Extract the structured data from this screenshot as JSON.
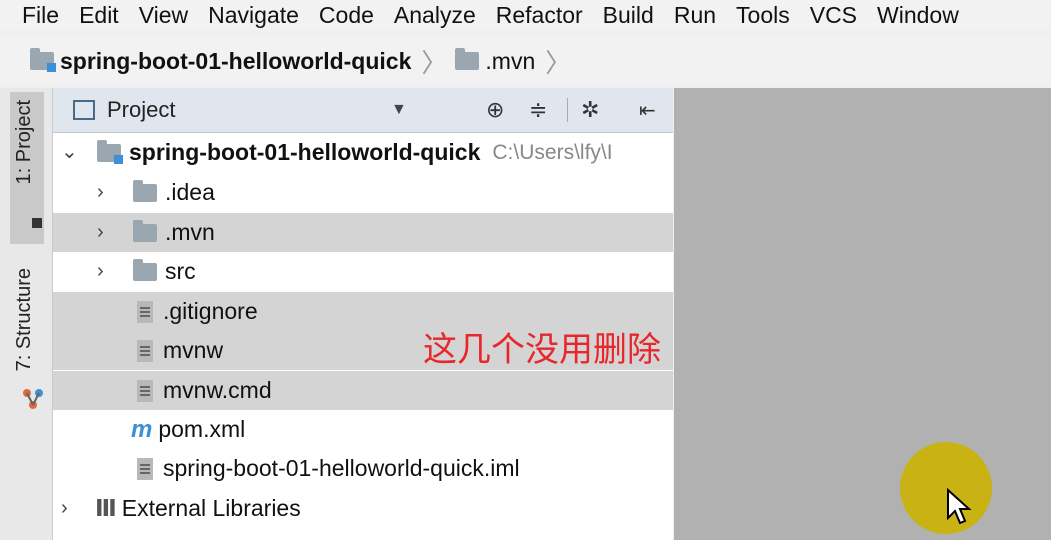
{
  "menu": [
    "File",
    "Edit",
    "View",
    "Navigate",
    "Code",
    "Analyze",
    "Refactor",
    "Build",
    "Run",
    "Tools",
    "VCS",
    "Window"
  ],
  "breadcrumb": {
    "project": "spring-boot-01-helloworld-quick",
    "folder": ".mvn"
  },
  "side_tabs": {
    "project": "1: Project",
    "structure": "7: Structure"
  },
  "panel": {
    "title": "Project"
  },
  "tree": {
    "root": "spring-boot-01-helloworld-quick",
    "root_path": "C:\\Users\\lfy\\I",
    "items": [
      ".idea",
      ".mvn",
      "src",
      ".gitignore",
      "mvnw",
      "mvnw.cmd",
      "pom.xml",
      "spring-boot-01-helloworld-quick.iml"
    ],
    "external": "External Libraries"
  },
  "annotation": "这几个没用删除",
  "colors": {
    "accent": "#3d8fd6",
    "annotation": "#e8262b",
    "cursor_highlight": "#c9b20c",
    "selection": "#d4d4d4"
  }
}
